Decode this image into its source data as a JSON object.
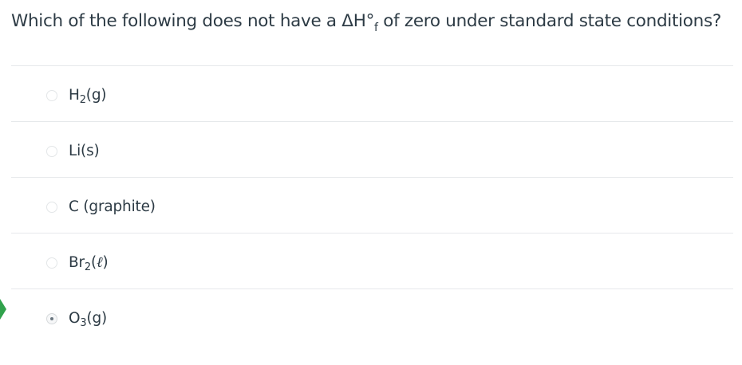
{
  "question": {
    "prefix": "Which of the following does not have a ΔH°",
    "subscript": "f",
    "suffix": " of zero under standard state conditions?"
  },
  "answers": [
    {
      "base": "H",
      "sub": "2",
      "rest": "(g)",
      "selected": false
    },
    {
      "base": "Li(s)",
      "sub": "",
      "rest": "",
      "selected": false
    },
    {
      "base": "C (graphite)",
      "sub": "",
      "rest": "",
      "selected": false
    },
    {
      "base": "Br",
      "sub": "2",
      "rest_open": "(",
      "rest_italic": "ℓ",
      "rest_close": ")",
      "selected": false
    },
    {
      "base": "O",
      "sub": "3",
      "rest": "(g)",
      "selected": true
    }
  ],
  "colors": {
    "text": "#2d3b45",
    "divider": "#e6e9eb",
    "correct_indicator": "#31a24c"
  },
  "icons": {
    "correct_indicator": "correct-answer-arrow-icon",
    "radio": "radio-button-icon"
  }
}
